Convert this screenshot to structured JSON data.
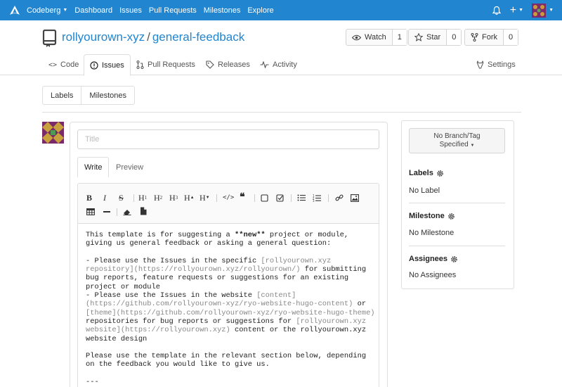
{
  "nav": {
    "brand": "Codeberg",
    "links": [
      "Dashboard",
      "Issues",
      "Pull Requests",
      "Milestones",
      "Explore"
    ]
  },
  "repo": {
    "owner": "rollyourown-xyz",
    "separator": "/",
    "name": "general-feedback",
    "watch_label": "Watch",
    "watch_count": "1",
    "star_label": "Star",
    "star_count": "0",
    "fork_label": "Fork",
    "fork_count": "0"
  },
  "tabs": {
    "code": "Code",
    "issues": "Issues",
    "pulls": "Pull Requests",
    "releases": "Releases",
    "activity": "Activity",
    "settings": "Settings"
  },
  "subnav": {
    "labels": "Labels",
    "milestones": "Milestones"
  },
  "editor": {
    "title_placeholder": "Title",
    "tab_write": "Write",
    "tab_preview": "Preview"
  },
  "content": {
    "p1_a": "This template is for suggesting a ",
    "p1_bold": "**new**",
    "p1_b": " project or module,",
    "p1_c": "giving us general feedback or asking a general question:",
    "l1_a": "- Please use the Issues in the specific ",
    "l1_link": "[rollyourown.xyz",
    "l2_link": "repository]",
    "l2_url": "(https://rollyourown.xyz/rollyourown/)",
    "l2_b": " for submitting",
    "l3": "bug reports, feature requests or suggestions for an existing",
    "l4": "project or module",
    "l5_a": "- Please use the Issues in the website ",
    "l5_link": "[content]",
    "l6_url": "(https://github.com/rollyourown-xyz/ryo-website-hugo-content)",
    "l6_b": " or",
    "l7_link": "[theme]",
    "l7_url": "(https://github.com/rollyourown-xyz/ryo-website-hugo-theme)",
    "l8_a": "repositories for bug reports or suggestions for ",
    "l8_link": "[rollyourown.xyz",
    "l9_link": "website]",
    "l9_url": "(https://rollyourown.xyz)",
    "l9_b": " content or the rollyourown.xyz",
    "l10": "website design",
    "p3_a": "Please use the template in the relevant section below, depending",
    "p3_b": "on the feedback you would like to give us.",
    "rule": "---"
  },
  "sidebar": {
    "branch_line1": "No Branch/Tag",
    "branch_line2": "Specified",
    "labels_title": "Labels",
    "labels_value": "No Label",
    "milestone_title": "Milestone",
    "milestone_value": "No Milestone",
    "assignees_title": "Assignees",
    "assignees_value": "No Assignees"
  },
  "colors": {
    "nav_bg": "#2185d0",
    "link": "#2185d0",
    "avatar": "#7a2a6a"
  }
}
